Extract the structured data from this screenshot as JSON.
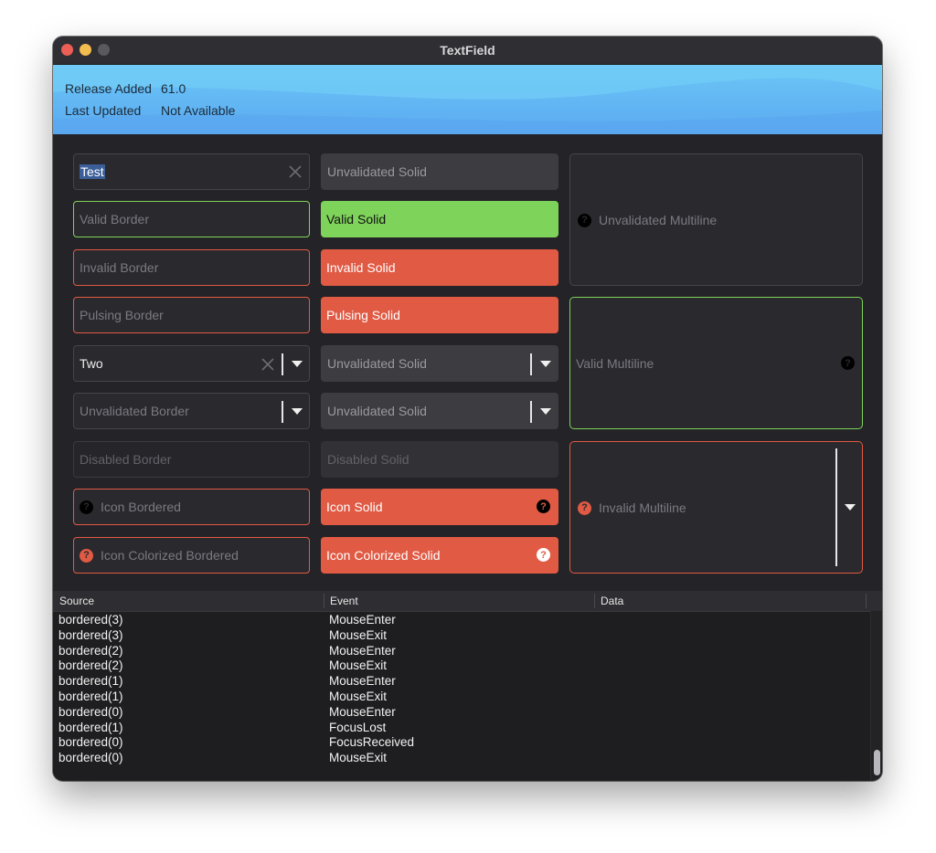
{
  "window": {
    "title": "TextField"
  },
  "meta": {
    "release_label": "Release Added",
    "release_value": "61.0",
    "updated_label": "Last Updated",
    "updated_value": "Not Available"
  },
  "fields": {
    "test_value": "Test",
    "unvalidated_solid": "Unvalidated Solid",
    "valid_border": "Valid Border",
    "valid_solid": "Valid Solid",
    "invalid_border": "Invalid Border",
    "invalid_solid": "Invalid Solid",
    "pulsing_border": "Pulsing Border",
    "pulsing_solid": "Pulsing Solid",
    "combo_two": "Two",
    "combo_unvalidated_solid_1": "Unvalidated Solid",
    "combo_unvalidated_border": "Unvalidated Border",
    "combo_unvalidated_solid_2": "Unvalidated Solid",
    "disabled_border": "Disabled Border",
    "disabled_solid": "Disabled Solid",
    "icon_bordered": "Icon Bordered",
    "icon_solid": "Icon Solid",
    "icon_colorized_bordered": "Icon Colorized Bordered",
    "icon_colorized_solid": "Icon Colorized Solid",
    "unvalidated_multiline": "Unvalidated Multiline",
    "valid_multiline": "Valid Multiline",
    "invalid_multiline": "Invalid Multiline",
    "icon_glyph": "?"
  },
  "colors": {
    "valid": "#7ed35a",
    "invalid": "#e05a44",
    "banner": "#5aaaf1"
  },
  "log": {
    "columns": [
      "Source",
      "Event",
      "Data"
    ],
    "rows": [
      [
        "bordered(3)",
        "MouseEnter",
        ""
      ],
      [
        "bordered(3)",
        "MouseExit",
        ""
      ],
      [
        "bordered(2)",
        "MouseEnter",
        ""
      ],
      [
        "bordered(2)",
        "MouseExit",
        ""
      ],
      [
        "bordered(1)",
        "MouseEnter",
        ""
      ],
      [
        "bordered(1)",
        "MouseExit",
        ""
      ],
      [
        "bordered(0)",
        "MouseEnter",
        ""
      ],
      [
        "bordered(1)",
        "FocusLost",
        ""
      ],
      [
        "bordered(0)",
        "FocusReceived",
        ""
      ],
      [
        "bordered(0)",
        "MouseExit",
        ""
      ]
    ]
  }
}
